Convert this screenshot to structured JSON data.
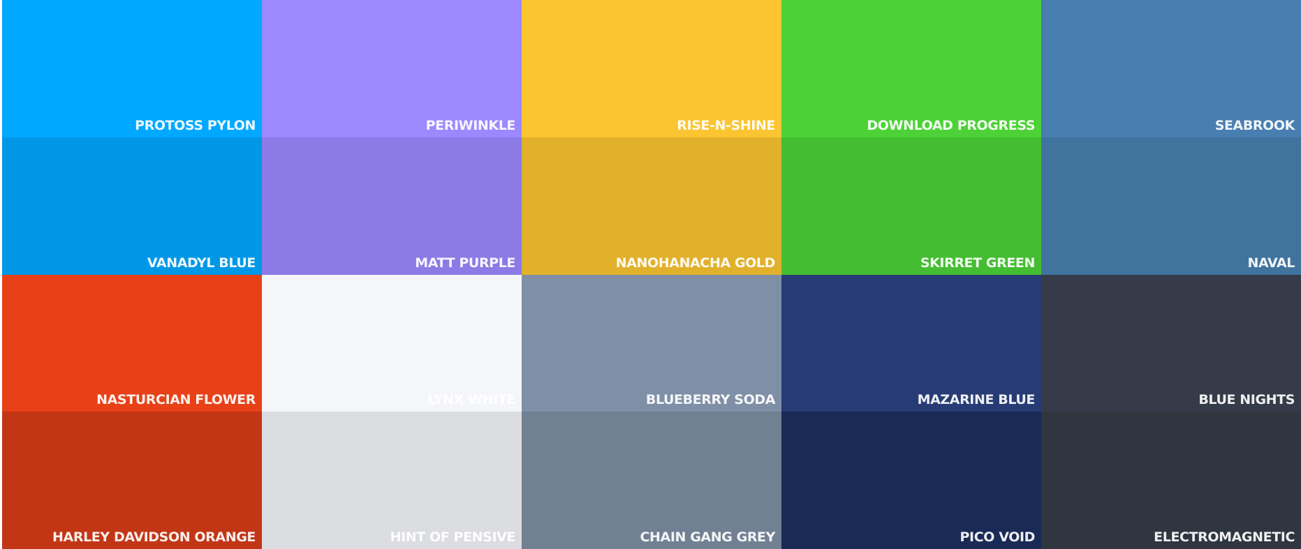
{
  "swatches": [
    {
      "name": "PROTOSS PYLON",
      "hex": "#00a8ff"
    },
    {
      "name": "PERIWINKLE",
      "hex": "#9c88ff"
    },
    {
      "name": "RISE-N-SHINE",
      "hex": "#fbc531"
    },
    {
      "name": "DOWNLOAD PROGRESS",
      "hex": "#4cd137"
    },
    {
      "name": "SEABROOK",
      "hex": "#487eb0"
    },
    {
      "name": "VANADYL BLUE",
      "hex": "#0097e6"
    },
    {
      "name": "MATT PURPLE",
      "hex": "#8c7ae6"
    },
    {
      "name": "NANOHANACHA GOLD",
      "hex": "#e1b12c"
    },
    {
      "name": "SKIRRET GREEN",
      "hex": "#44bd32"
    },
    {
      "name": "NAVAL",
      "hex": "#40739e"
    },
    {
      "name": "NASTURCIAN FLOWER",
      "hex": "#e84118"
    },
    {
      "name": "LYNX WHITE",
      "hex": "#f5f6fa"
    },
    {
      "name": "BLUEBERRY SODA",
      "hex": "#7f8fa6"
    },
    {
      "name": "MAZARINE BLUE",
      "hex": "#273c75"
    },
    {
      "name": "BLUE NIGHTS",
      "hex": "#353b48"
    },
    {
      "name": "HARLEY DAVIDSON ORANGE",
      "hex": "#c23616"
    },
    {
      "name": "HINT OF PENSIVE",
      "hex": "#dcdde1"
    },
    {
      "name": "CHAIN GANG GREY",
      "hex": "#718093"
    },
    {
      "name": "PICO VOID",
      "hex": "#192a56"
    },
    {
      "name": "ELECTROMAGNETIC",
      "hex": "#2f3640"
    }
  ]
}
